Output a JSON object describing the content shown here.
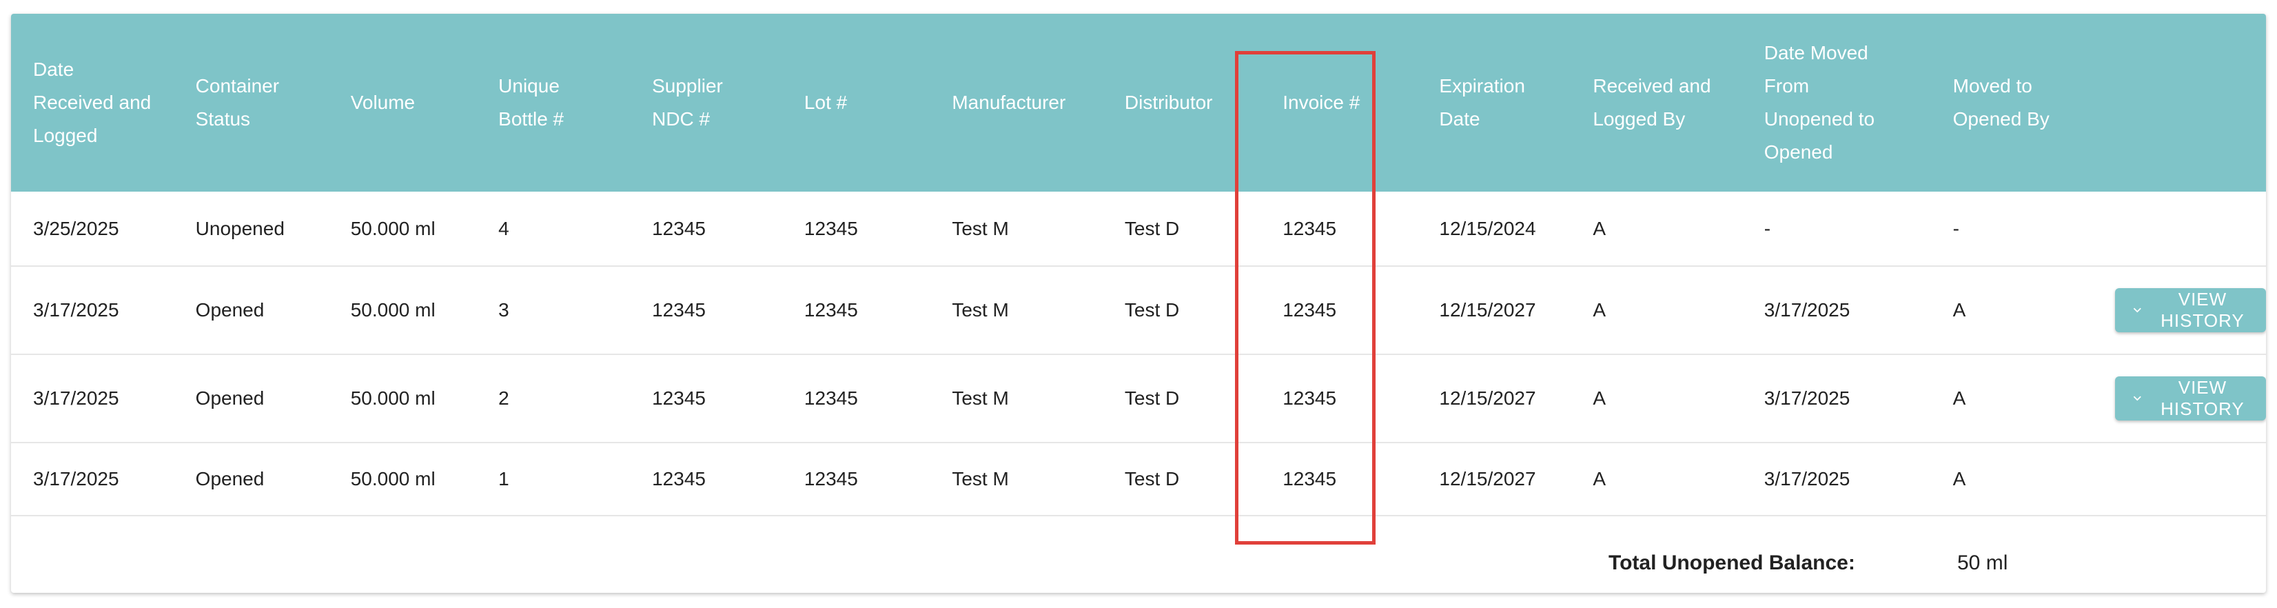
{
  "table": {
    "columns": [
      {
        "lines": [
          "Date",
          "Received and",
          "Logged"
        ]
      },
      {
        "lines": [
          "Container",
          "Status"
        ]
      },
      {
        "lines": [
          "Volume"
        ]
      },
      {
        "lines": [
          "Unique",
          "Bottle #"
        ]
      },
      {
        "lines": [
          "Supplier",
          "NDC #"
        ]
      },
      {
        "lines": [
          "Lot #"
        ]
      },
      {
        "lines": [
          "Manufacturer"
        ]
      },
      {
        "lines": [
          "Distributor"
        ]
      },
      {
        "lines": [
          "Invoice #"
        ]
      },
      {
        "lines": [
          "Expiration",
          "Date"
        ]
      },
      {
        "lines": [
          "Received and",
          "Logged By"
        ]
      },
      {
        "lines": [
          "Date Moved",
          "From",
          "Unopened to",
          "Opened"
        ]
      },
      {
        "lines": [
          "Moved to",
          "Opened By"
        ]
      },
      {
        "lines": []
      }
    ],
    "rows": [
      {
        "cells": [
          "3/25/2025",
          "Unopened",
          "50.000 ml",
          "4",
          "12345",
          "12345",
          "Test M",
          "Test D",
          "12345",
          "12/15/2024",
          "A",
          "-",
          "-"
        ]
      },
      {
        "cells": [
          "3/17/2025",
          "Opened",
          "50.000 ml",
          "3",
          "12345",
          "12345",
          "Test M",
          "Test D",
          "12345",
          "12/15/2027",
          "A",
          "3/17/2025",
          "A"
        ]
      },
      {
        "cells": [
          "3/17/2025",
          "Opened",
          "50.000 ml",
          "2",
          "12345",
          "12345",
          "Test M",
          "Test D",
          "12345",
          "12/15/2027",
          "A",
          "3/17/2025",
          "A"
        ]
      },
      {
        "cells": [
          "3/17/2025",
          "Opened",
          "50.000 ml",
          "1",
          "12345",
          "12345",
          "Test M",
          "Test D",
          "12345",
          "12/15/2027",
          "A",
          "3/17/2025",
          "A"
        ]
      }
    ],
    "history_button": {
      "label": "VIEW HISTORY",
      "icon": "chevron-down-icon"
    }
  },
  "total": {
    "label": "Total Unopened Balance:",
    "value": "50 ml"
  },
  "colors": {
    "header_bg": "#7fc4c8",
    "button_bg": "#7fc4c8",
    "highlight": "#e0403a"
  }
}
